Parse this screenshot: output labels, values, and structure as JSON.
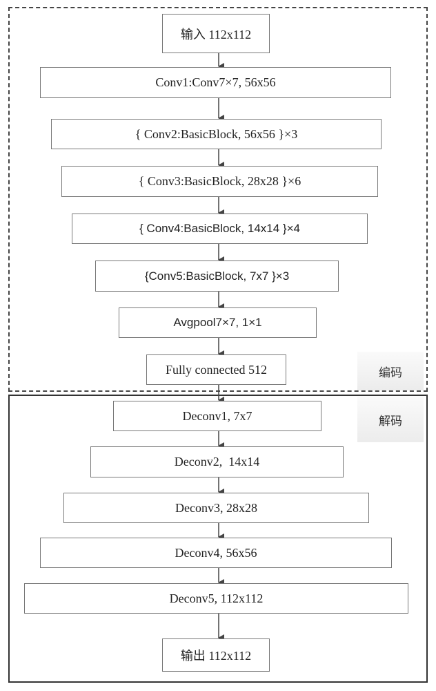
{
  "encoder": {
    "label": "编码",
    "nodes": [
      {
        "id": "input",
        "text": "输入 112x112"
      },
      {
        "id": "conv1",
        "text": "Conv1:Conv7×7, 56x56"
      },
      {
        "id": "conv2",
        "text": "{ Conv2:BasicBlock, 56x56 }×3"
      },
      {
        "id": "conv3",
        "text": "{ Conv3:BasicBlock, 28x28 }×6"
      },
      {
        "id": "conv4",
        "text": "{ Conv4:BasicBlock, 14x14 }×4"
      },
      {
        "id": "conv5",
        "text": "{Conv5:BasicBlock, 7x7 }×3"
      },
      {
        "id": "avgpool",
        "text": "Avgpool7×7, 1×1"
      },
      {
        "id": "fc",
        "text": "Fully connected 512"
      }
    ]
  },
  "decoder": {
    "label": "解码",
    "nodes": [
      {
        "id": "deconv1",
        "text": "Deconv1, 7x7"
      },
      {
        "id": "deconv2",
        "text": "Deconv2,  14x14"
      },
      {
        "id": "deconv3",
        "text": "Deconv3, 28x28"
      },
      {
        "id": "deconv4",
        "text": "Deconv4, 56x56"
      },
      {
        "id": "deconv5",
        "text": "Deconv5, 112x112"
      },
      {
        "id": "output",
        "text": "输出 112x112"
      }
    ]
  },
  "colors": {
    "border": "#777777",
    "arrow": "#444444",
    "tag_bg": "#eeeeee"
  }
}
